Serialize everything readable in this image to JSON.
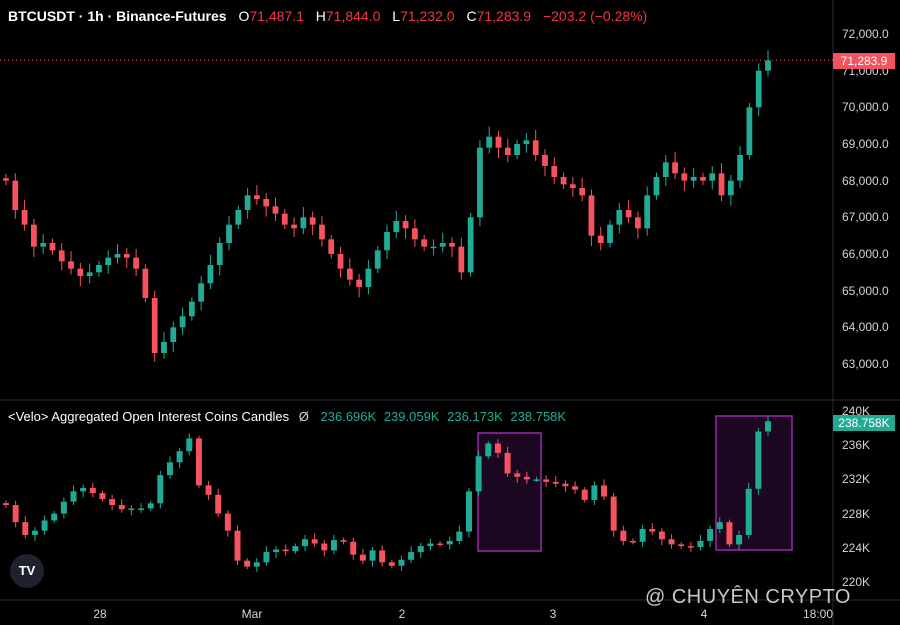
{
  "header": {
    "symbol": "BTCUSDT · 1h · Binance-Futures",
    "o_label": "O",
    "o_value": "71,487.1",
    "h_label": "H",
    "h_value": "71,844.0",
    "l_label": "L",
    "l_value": "71,232.0",
    "c_label": "C",
    "c_value": "71,283.9",
    "change": "−203.2 (−0.28%)"
  },
  "oi_header": {
    "title": "<Velo> Aggregated Open Interest Coins Candles",
    "symbol": "Ø",
    "v1": "236.696K",
    "v2": "239.059K",
    "v3": "236.173K",
    "v4": "238.758K"
  },
  "price_axis": {
    "ticks": [
      "72,000.0",
      "71,000.0",
      "70,000.0",
      "69,000.0",
      "68,000.0",
      "67,000.0",
      "66,000.0",
      "65,000.0",
      "64,000.0",
      "63,000.0"
    ],
    "last_badge": "71,283.9"
  },
  "oi_axis": {
    "ticks": [
      "240K",
      "236K",
      "232K",
      "228K",
      "224K",
      "220K"
    ],
    "last_badge": "238.758K"
  },
  "time_axis": {
    "ticks": [
      "28",
      "Mar",
      "2",
      "3",
      "4",
      "18:00"
    ]
  },
  "watermark": "@ CHUYÊN CRYPTO",
  "logo_text": "TV",
  "colors": {
    "up": "#22ab94",
    "down": "#f7525f",
    "price_line": "#f7525f",
    "highlight": "#9c27b0",
    "badge": "#f7525f",
    "oi_badge": "#22ab94"
  },
  "chart_data": [
    {
      "type": "line",
      "title": "BTCUSDT · 1h · Binance-Futures",
      "ylim": [
        62500,
        72300
      ],
      "x_tick_labels": [
        "28",
        "Mar",
        "2",
        "3",
        "4",
        "18:00"
      ],
      "last_price": 71283.9,
      "series": [
        {
          "name": "BTCUSDT",
          "values": [
            68000,
            67200,
            66800,
            66200,
            66300,
            66100,
            65800,
            65600,
            65400,
            65500,
            65700,
            65900,
            66000,
            65900,
            65600,
            64800,
            63300,
            63600,
            64000,
            64300,
            64700,
            65200,
            65700,
            66300,
            66800,
            67200,
            67600,
            67500,
            67300,
            67100,
            66800,
            66700,
            67000,
            66800,
            66400,
            66000,
            65600,
            65300,
            65100,
            65600,
            66100,
            66600,
            66900,
            66700,
            66400,
            66200,
            66200,
            66300,
            66200,
            65500,
            67000,
            68900,
            69200,
            68900,
            68700,
            69000,
            69100,
            68700,
            68400,
            68100,
            67900,
            67800,
            67600,
            66500,
            66300,
            66800,
            67200,
            67000,
            66700,
            67600,
            68100,
            68500,
            68200,
            68000,
            68100,
            68000,
            68200,
            67600,
            68000,
            68700,
            70000,
            71000,
            71280
          ]
        }
      ]
    },
    {
      "type": "line",
      "title": "<Velo> Aggregated Open Interest Coins Candles",
      "ylim": [
        219500,
        240500
      ],
      "x_tick_labels": [
        "28",
        "Mar",
        "2",
        "3",
        "4",
        "18:00"
      ],
      "last_value": 238.758,
      "series": [
        {
          "name": "<Velo> Aggregated Open Interest Coins Candles",
          "values": [
            229000,
            227000,
            225500,
            226000,
            227200,
            228000,
            229400,
            230600,
            231000,
            230400,
            229700,
            229000,
            228500,
            228600,
            228600,
            229200,
            232500,
            234000,
            235300,
            236800,
            231300,
            230200,
            228000,
            226000,
            222500,
            221800,
            222300,
            223500,
            223800,
            223600,
            224200,
            225000,
            224500,
            223700,
            224900,
            224700,
            223200,
            222500,
            223700,
            222300,
            221900,
            222600,
            223500,
            224200,
            224500,
            224400,
            224800,
            225900,
            230600,
            234700,
            236200,
            235100,
            232700,
            232300,
            232000,
            232000,
            231700,
            231500,
            231200,
            230800,
            229600,
            231300,
            230000,
            226000,
            224800,
            224700,
            226200,
            225900,
            225000,
            224400,
            224200,
            224100,
            224800,
            226200,
            227000,
            224400,
            225500,
            230900,
            237600,
            238800
          ]
        }
      ]
    }
  ]
}
